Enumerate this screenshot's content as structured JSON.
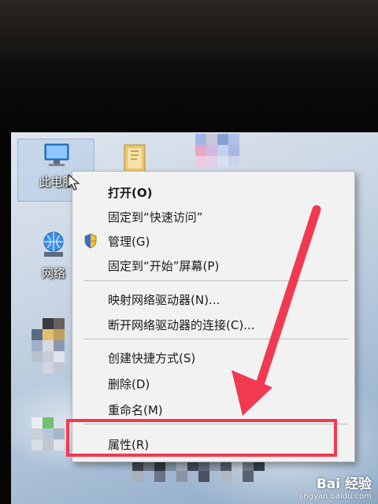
{
  "desktop": {
    "this_pc_label": "此电脑",
    "network_label": "网络"
  },
  "context_menu": {
    "items": [
      {
        "label": "打开(O)"
      },
      {
        "label": "固定到“快速访问”"
      },
      {
        "label": "管理(G)"
      },
      {
        "label": "固定到“开始”屏幕(P)"
      },
      {
        "label": "映射网络驱动器(N)..."
      },
      {
        "label": "断开网络驱动器的连接(C)..."
      },
      {
        "label": "创建快捷方式(S)"
      },
      {
        "label": "删除(D)"
      },
      {
        "label": "重命名(M)"
      },
      {
        "label": "属性(R)"
      }
    ]
  },
  "annotation": {
    "color": "#f03a52"
  },
  "watermark": {
    "logo": "Bai 经验",
    "url": "jingyan.baidu.com"
  }
}
